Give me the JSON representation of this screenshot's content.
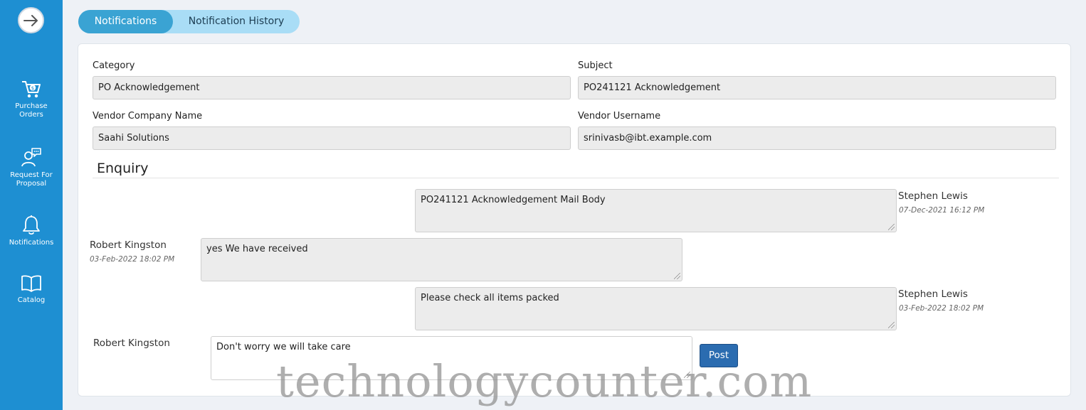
{
  "sidebar": {
    "toggle_icon": "arrow-right-icon",
    "items": [
      {
        "label": "Purchase Orders",
        "icon": "cart-icon"
      },
      {
        "label": "Request For Proposal",
        "icon": "user-chat-icon"
      },
      {
        "label": "Notifications",
        "icon": "bell-icon"
      },
      {
        "label": "Catalog",
        "icon": "book-icon"
      }
    ]
  },
  "tabs": [
    {
      "label": "Notifications",
      "active": true
    },
    {
      "label": "Notification History",
      "active": false
    }
  ],
  "form": {
    "category": {
      "label": "Category",
      "value": "PO Acknowledgement"
    },
    "subject": {
      "label": "Subject",
      "value": "PO241121 Acknowledgement"
    },
    "vendor_company": {
      "label": "Vendor Company Name",
      "value": "Saahi Solutions"
    },
    "vendor_username": {
      "label": "Vendor Username",
      "value": "srinivasb@ibt.example.com"
    }
  },
  "enquiry": {
    "title": "Enquiry",
    "messages": [
      {
        "author": "Stephen Lewis",
        "time": "07-Dec-2021 16:12 PM",
        "text": "PO241121 Acknowledgement Mail Body",
        "side": "right"
      },
      {
        "author": "Robert Kingston",
        "time": "03-Feb-2022 18:02 PM",
        "text": "yes We have received",
        "side": "left"
      },
      {
        "author": "Stephen Lewis",
        "time": "03-Feb-2022 18:02 PM",
        "text": "Please check all items packed",
        "side": "right"
      }
    ],
    "reply": {
      "author": "Robert Kingston",
      "text": "Don't worry we will take care",
      "button": "Post"
    }
  },
  "watermark": "technologycounter.com",
  "colors": {
    "sidebar": "#1e8fd2",
    "tab_active": "#3aa3d3",
    "tab_inactive": "#a9ddf6",
    "post_button": "#2b6cb0"
  }
}
